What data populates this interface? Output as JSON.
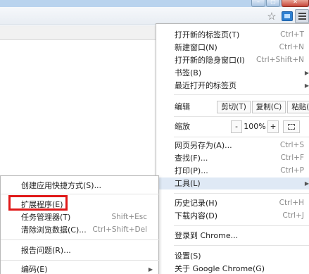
{
  "window": {
    "buttons": [
      "minimize",
      "maximize",
      "close"
    ]
  },
  "toolbar": {
    "icons": [
      "bookmark-star-icon",
      "extension-icon",
      "chrome-menu-icon"
    ]
  },
  "main_menu": {
    "new_tab": {
      "label": "打开新的标签页(T)",
      "shortcut": "Ctrl+T"
    },
    "new_window": {
      "label": "新建窗口(N)",
      "shortcut": "Ctrl+N"
    },
    "incognito": {
      "label": "打开新的隐身窗口(I)",
      "shortcut": "Ctrl+Shift+N"
    },
    "bookmarks": {
      "label": "书签(B)"
    },
    "recent_tabs": {
      "label": "最近打开的标签页"
    },
    "edit": {
      "label": "编辑",
      "cut": "剪切(T)",
      "copy": "复制(C)",
      "paste": "粘贴(P)"
    },
    "zoom": {
      "label": "缩放",
      "minus": "-",
      "value": "100%",
      "plus": "+"
    },
    "save_as": {
      "label": "网页另存为(A)...",
      "shortcut": "Ctrl+S"
    },
    "find": {
      "label": "查找(F)...",
      "shortcut": "Ctrl+F"
    },
    "print": {
      "label": "打印(P)...",
      "shortcut": "Ctrl+P"
    },
    "tools": {
      "label": "工具(L)"
    },
    "history": {
      "label": "历史记录(H)",
      "shortcut": "Ctrl+H"
    },
    "downloads": {
      "label": "下载内容(D)",
      "shortcut": "Ctrl+J"
    },
    "sign_in": {
      "label": "登录到 Chrome..."
    },
    "settings": {
      "label": "设置(S)"
    },
    "about": {
      "label": "关于 Google Chrome(G)"
    }
  },
  "tools_submenu": {
    "create_shortcut": {
      "label": "创建应用快捷方式(S)..."
    },
    "extensions": {
      "label": "扩展程序(E)"
    },
    "task_manager": {
      "label": "任务管理器(T)",
      "shortcut": "Shift+Esc"
    },
    "clear_data": {
      "label": "清除浏览数据(C)...",
      "shortcut": "Ctrl+Shift+Del"
    },
    "report_issue": {
      "label": "报告问题(R)..."
    },
    "encoding": {
      "label": "编码(E)"
    }
  },
  "colors": {
    "highlight_border": "#e01818",
    "hover_bg": "#dfe9f5"
  }
}
